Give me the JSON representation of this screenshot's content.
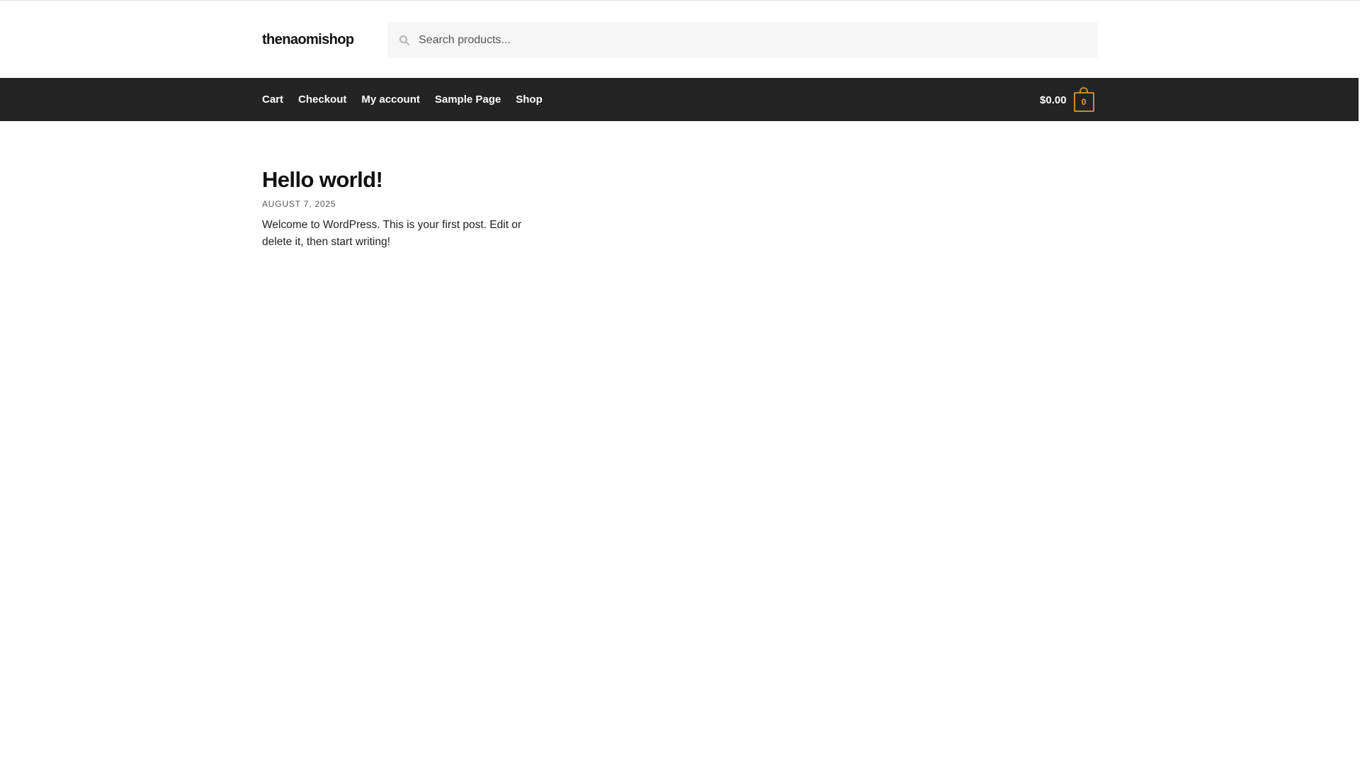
{
  "site": {
    "title": "thenaomishop"
  },
  "search": {
    "placeholder": "Search products...",
    "value": ""
  },
  "nav": {
    "items": [
      {
        "label": "Cart"
      },
      {
        "label": "Checkout"
      },
      {
        "label": "My account"
      },
      {
        "label": "Sample Page"
      },
      {
        "label": "Shop"
      }
    ]
  },
  "cart": {
    "amount": "$0.00",
    "count": "0"
  },
  "post": {
    "title": "Hello world!",
    "date": "AUGUST 7, 2025",
    "excerpt": "Welcome to WordPress. This is your first post. Edit or delete it, then start writing!"
  },
  "colors": {
    "nav_background": "#242424",
    "cart_accent": "#e7a035",
    "search_background": "#f6f6f6"
  },
  "icons": {
    "search": "search-icon",
    "cart": "cart-bag-icon"
  }
}
